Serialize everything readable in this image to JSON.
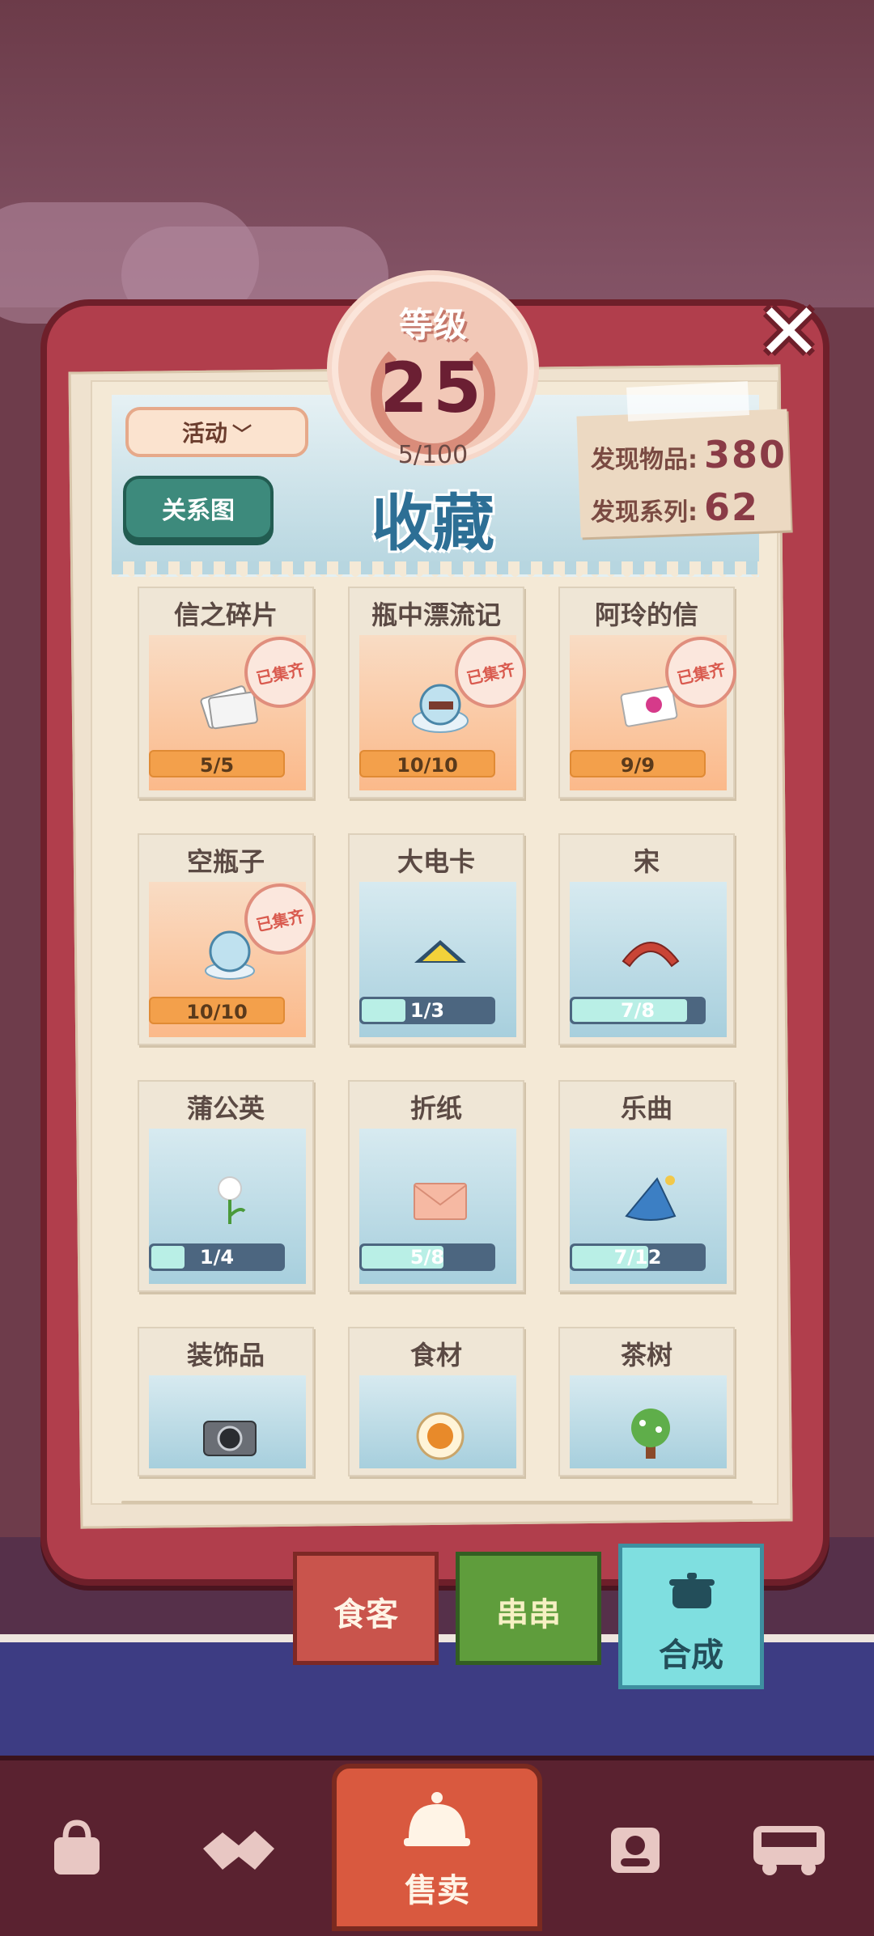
{
  "header": {
    "level_title": "等级",
    "level_value": "25",
    "level_progress": "5/100",
    "title": "收藏"
  },
  "controls": {
    "filter_label": "活动",
    "relation_label": "关系图",
    "close": "✕"
  },
  "stats": {
    "items_label": "发现物品:",
    "items_value": "380",
    "series_label": "发现系列:",
    "series_value": "62"
  },
  "stamp_text": "已集齐",
  "cards": [
    {
      "title": "信之碎片",
      "progress": "5/5",
      "fraction": 1.0,
      "complete": true,
      "icon": "letters-icon"
    },
    {
      "title": "瓶中漂流记",
      "progress": "10/10",
      "fraction": 1.0,
      "complete": true,
      "icon": "ship-in-bottle-icon"
    },
    {
      "title": "阿玲的信",
      "progress": "9/9",
      "fraction": 1.0,
      "complete": true,
      "icon": "sealed-letter-icon"
    },
    {
      "title": "空瓶子",
      "progress": "10/10",
      "fraction": 1.0,
      "complete": true,
      "icon": "snow-globe-icon"
    },
    {
      "title": "大电卡",
      "progress": "1/3",
      "fraction": 0.333,
      "complete": false,
      "icon": "transit-card-icon"
    },
    {
      "title": "宋",
      "progress": "7/8",
      "fraction": 0.875,
      "complete": false,
      "icon": "arch-bridge-icon"
    },
    {
      "title": "蒲公英",
      "progress": "1/4",
      "fraction": 0.25,
      "complete": false,
      "icon": "dandelion-icon"
    },
    {
      "title": "折纸",
      "progress": "5/8",
      "fraction": 0.625,
      "complete": false,
      "icon": "envelope-icon"
    },
    {
      "title": "乐曲",
      "progress": "7/12",
      "fraction": 0.583,
      "complete": false,
      "icon": "wizard-hat-icon"
    },
    {
      "title": "装饰品",
      "icon": "camera-icon"
    },
    {
      "title": "食材",
      "icon": "food-plate-icon"
    },
    {
      "title": "茶树",
      "icon": "tea-tree-icon"
    }
  ],
  "tabs": {
    "guests": "食客",
    "skewers": "串串",
    "craft": "合成"
  },
  "bottom_nav": {
    "sell": "售卖"
  },
  "colors": {
    "frame": "#b13e4c",
    "complete_bar": "#f3a04b",
    "partial_fill": "#b9efe6",
    "title_blue": "#2d6f95"
  }
}
